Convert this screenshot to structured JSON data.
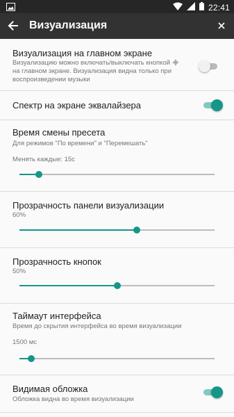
{
  "colors": {
    "accent": "#159688",
    "toggle_on_track": "#7fcac1",
    "toggle_off_track": "#b9b9b9",
    "toggle_off_knob": "#f1f1f1"
  },
  "status_bar": {
    "time": "22:41",
    "left_icon": "image-icon",
    "right_icons": [
      "wifi-icon",
      "signal-icon",
      "battery-icon"
    ]
  },
  "app_bar": {
    "title": "Визуализация",
    "back_icon": "arrow-back-icon",
    "close_icon": "close-icon"
  },
  "settings": {
    "home_visualization": {
      "title": "Визуализация на главном экране",
      "summary": "Визуализацию можно включать/выключать кнопкой ᯽ на главном экране. Визуализация видна только при воспроизведении музыки",
      "enabled": false
    },
    "equalizer_spectrum": {
      "title": "Спектр на экране эквалайзера",
      "enabled": true
    },
    "preset_change_time": {
      "title": "Время смены пресета",
      "summary": "Для режимов \"По времени\" и \"Перемешать\"",
      "value_label": "Менять каждые: 15с",
      "level": 0.1
    },
    "panel_transparency": {
      "title": "Прозрачность панели визуализации",
      "value_label": "60%",
      "level": 0.6
    },
    "buttons_transparency": {
      "title": "Прозрачность кнопок",
      "value_label": "50%",
      "level": 0.5
    },
    "interface_timeout": {
      "title": "Таймаут интерфейса",
      "summary": "Время до скрытия интерфейса во время визуализации",
      "value_label": "1500 мс",
      "level": 0.06
    },
    "visible_cover": {
      "title": "Видимая обложка",
      "summary": "Обложка видна во время визуализации",
      "enabled": true
    }
  }
}
